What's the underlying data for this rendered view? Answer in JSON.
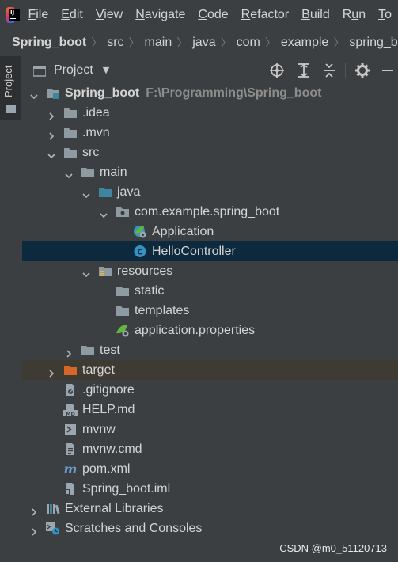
{
  "menu": {
    "items": [
      {
        "pre": "",
        "ul": "F",
        "post": "ile"
      },
      {
        "pre": "",
        "ul": "E",
        "post": "dit"
      },
      {
        "pre": "",
        "ul": "V",
        "post": "iew"
      },
      {
        "pre": "",
        "ul": "N",
        "post": "avigate"
      },
      {
        "pre": "",
        "ul": "C",
        "post": "ode"
      },
      {
        "pre": "",
        "ul": "R",
        "post": "efactor"
      },
      {
        "pre": "",
        "ul": "B",
        "post": "uild"
      },
      {
        "pre": "R",
        "ul": "u",
        "post": "n"
      },
      {
        "pre": "",
        "ul": "T",
        "post": "o"
      }
    ]
  },
  "breadcrumb": [
    "Spring_boot",
    "src",
    "main",
    "java",
    "com",
    "example",
    "spring_boot"
  ],
  "toolstrip": {
    "project_tab": "Project"
  },
  "panel": {
    "title": "Project"
  },
  "tree": [
    {
      "label": "Spring_boot",
      "path": "F:\\Programming\\Spring_boot",
      "depth": 0,
      "arrow": "down",
      "icon": "module-folder-icon",
      "bold": true
    },
    {
      "label": ".idea",
      "depth": 1,
      "arrow": "right",
      "icon": "folder-icon"
    },
    {
      "label": ".mvn",
      "depth": 1,
      "arrow": "right",
      "icon": "folder-icon"
    },
    {
      "label": "src",
      "depth": 1,
      "arrow": "down",
      "icon": "folder-icon"
    },
    {
      "label": "main",
      "depth": 2,
      "arrow": "down",
      "icon": "folder-icon"
    },
    {
      "label": "java",
      "depth": 3,
      "arrow": "down",
      "icon": "source-folder-icon"
    },
    {
      "label": "com.example.spring_boot",
      "depth": 4,
      "arrow": "down",
      "icon": "package-icon"
    },
    {
      "label": "Application",
      "depth": 5,
      "arrow": "none",
      "icon": "spring-app-class-icon"
    },
    {
      "label": "HelloController",
      "depth": 5,
      "arrow": "none",
      "icon": "class-icon",
      "selected": true
    },
    {
      "label": "resources",
      "depth": 3,
      "arrow": "down",
      "icon": "resources-folder-icon"
    },
    {
      "label": "static",
      "depth": 4,
      "arrow": "none",
      "icon": "folder-icon"
    },
    {
      "label": "templates",
      "depth": 4,
      "arrow": "none",
      "icon": "folder-icon"
    },
    {
      "label": "application.properties",
      "depth": 4,
      "arrow": "none",
      "icon": "spring-properties-icon"
    },
    {
      "label": "test",
      "depth": 2,
      "arrow": "right",
      "icon": "folder-icon"
    },
    {
      "label": "target",
      "depth": 1,
      "arrow": "right",
      "icon": "excluded-folder-icon",
      "excluded": true
    },
    {
      "label": ".gitignore",
      "depth": 1,
      "arrow": "none",
      "icon": "gitignore-file-icon"
    },
    {
      "label": "HELP.md",
      "depth": 1,
      "arrow": "none",
      "icon": "markdown-file-icon"
    },
    {
      "label": "mvnw",
      "depth": 1,
      "arrow": "none",
      "icon": "shell-script-icon"
    },
    {
      "label": "mvnw.cmd",
      "depth": 1,
      "arrow": "none",
      "icon": "text-file-icon"
    },
    {
      "label": "pom.xml",
      "depth": 1,
      "arrow": "none",
      "icon": "maven-icon"
    },
    {
      "label": "Spring_boot.iml",
      "depth": 1,
      "arrow": "none",
      "icon": "iml-file-icon"
    },
    {
      "label": "External Libraries",
      "depth": 0,
      "arrow": "right",
      "icon": "libraries-icon"
    },
    {
      "label": "Scratches and Consoles",
      "depth": 0,
      "arrow": "right",
      "icon": "scratches-icon"
    }
  ],
  "watermark": "CSDN @m0_51120713",
  "colors": {
    "background": "#3c3f41",
    "selection": "#0d293e",
    "excluded_row": "#3d3b32",
    "folder": "#8f9ba3",
    "source_folder": "#3e86a0",
    "excluded_folder": "#d7662d",
    "class_icon": "#3592c4",
    "spring_green": "#62b543"
  }
}
